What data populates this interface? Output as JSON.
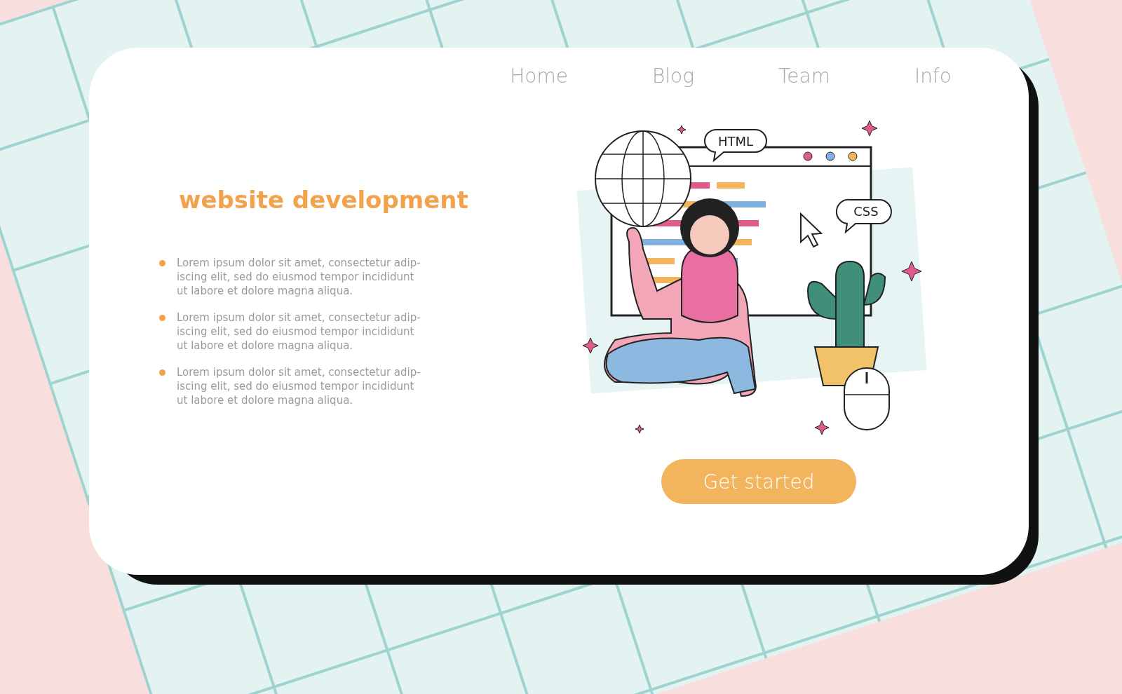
{
  "nav": [
    {
      "label": "Home"
    },
    {
      "label": "Blog"
    },
    {
      "label": "Team"
    },
    {
      "label": "Info"
    }
  ],
  "heading": "website development",
  "bullets": [
    "Lorem ipsum dolor sit amet, consectetur adip-iscing elit, sed do eiusmod tempor incididunt ut labore et dolore magna aliqua.",
    "Lorem ipsum dolor sit amet, consectetur adip-iscing elit, sed do eiusmod tempor incididunt ut labore et dolore magna aliqua.",
    "Lorem ipsum dolor sit amet, consectetur adip-iscing elit, sed do eiusmod tempor incididunt ut labore et dolore magna aliqua."
  ],
  "illustration": {
    "bubbles": [
      "HTML",
      "CSS"
    ]
  },
  "button": "Get started"
}
